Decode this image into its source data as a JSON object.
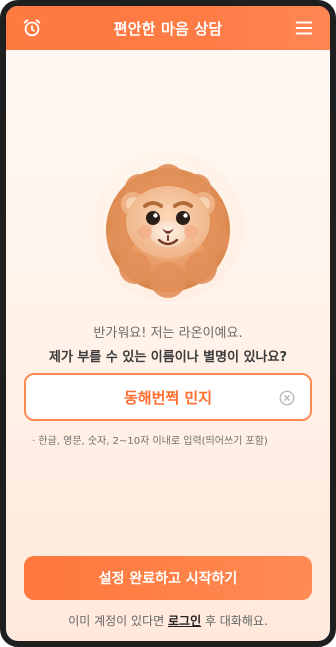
{
  "header": {
    "title": "편안한 마음 상담",
    "left_icon": "alarm-clock-icon",
    "right_icon": "hamburger-menu-icon"
  },
  "character": {
    "icon": "lion-mascot"
  },
  "messages": {
    "greeting": "반가워요! 저는 라온이예요.",
    "question": "제가 부를 수 있는 이름이나 별명이 있나요?"
  },
  "name_input": {
    "value": "동해번쩍 민지",
    "clear_icon": "clear-circle-x-icon",
    "hint": "· 한글, 영문, 숫자, 2~10자 이내로 입력(띄어쓰기 포함)"
  },
  "submit": {
    "label": "설정 완료하고 시작하기"
  },
  "footer": {
    "prefix": "이미 계정이 있다면",
    "link_label": "로그인",
    "suffix": "후 대화해요."
  },
  "colors": {
    "accent": "#ff7a3f",
    "accent_text": "#ff6d2f"
  }
}
